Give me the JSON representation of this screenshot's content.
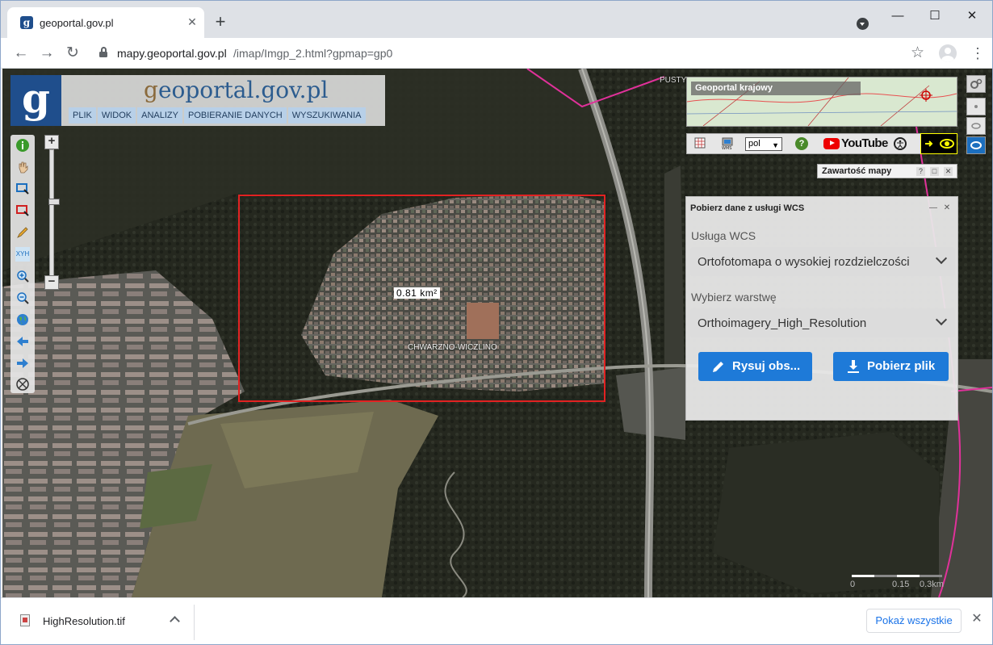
{
  "browser": {
    "tab_title": "geoportal.gov.pl",
    "tab_close": "✕",
    "new_tab": "+",
    "url_host": "mapy.geoportal.gov.pl",
    "url_path": "/imap/Imgp_2.html?gpmap=gp0",
    "back": "←",
    "forward": "→",
    "reload": "↻",
    "star": "☆",
    "menu": "⋮",
    "minimize": "—",
    "maximize": "☐",
    "close": "✕"
  },
  "geoportal": {
    "logo_letter": "g",
    "logo_text_prefix": "g",
    "logo_text_main": "eoportal",
    "logo_text_suffix": ".gov.pl",
    "menu": [
      "PLIK",
      "WIDOK",
      "ANALIZY",
      "POBIERANIE DANYCH",
      "WYSZUKIWANIA"
    ],
    "zoom_in": "+",
    "zoom_out": "−",
    "xyh_label": "XYH"
  },
  "map": {
    "area_label": "0.81 km²",
    "place_label": "CHWARZNO-WICZLINO",
    "pust_label": "PUSTY"
  },
  "overview": {
    "title": "Geoportal krajowy"
  },
  "toolrow": {
    "lang": "pol",
    "youtube": "YouTube",
    "help": "?"
  },
  "content_panel": {
    "title": "Zawartość mapy",
    "help": "?",
    "max": "□",
    "close": "✕"
  },
  "wcs_panel": {
    "title": "Pobierz dane z usługi WCS",
    "service_label": "Usługa WCS",
    "service_value": "Ortofotomapa o wysokiej rozdzielczości",
    "layer_label": "Wybierz warstwę",
    "layer_value": "Orthoimagery_High_Resolution",
    "draw_button": "Rysuj obs...",
    "download_button": "Pobierz plik"
  },
  "scale": {
    "labels": [
      "0",
      "0.15",
      "0.3km"
    ]
  },
  "download": {
    "file_name": "HighResolution.tif",
    "show_all": "Pokaż wszystkie",
    "close": "✕"
  },
  "colors": {
    "accent": "#1e7ad8",
    "selection": "#e22222",
    "boundary": "#e0319a"
  }
}
